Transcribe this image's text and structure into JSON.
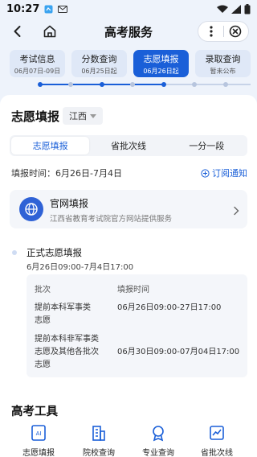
{
  "status_bar": {
    "time": "10:27",
    "icons": [
      "app-notification-icon",
      "mail-icon",
      "wifi-icon",
      "signal-icon",
      "battery-icon"
    ]
  },
  "header": {
    "title": "高考服务",
    "icons": [
      "back-icon",
      "home-icon",
      "more-icon",
      "close-icon"
    ]
  },
  "stages": [
    {
      "title": "考试信息",
      "date": "06月07日-09日"
    },
    {
      "title": "分数查询",
      "date": "06月25日起"
    },
    {
      "title": "志愿填报",
      "date": "06月26日起"
    },
    {
      "title": "录取查询",
      "date": "暂未公布"
    }
  ],
  "active_stage": 2,
  "colors": {
    "accent": "#1a5fd8",
    "page_bg": "#eef3fb",
    "panel_bg": "#f4f6fa"
  },
  "volunteer": {
    "section_title": "志愿填报",
    "region": "江西",
    "tabs": [
      "志愿填报",
      "省批次线",
      "一分一段"
    ],
    "active_tab": 0,
    "fill_time": "填报时间：6月26日-7月4日",
    "subscribe": "订阅通知",
    "official": {
      "title": "官网填报",
      "subtitle": "江西省教育考试院官方网站提供服务"
    },
    "formal": {
      "title": "正式志愿填报",
      "time": "6月26日09:00-7月4日17:00"
    },
    "table": {
      "headers": [
        "批次",
        "填报时间"
      ],
      "rows": [
        {
          "batch": [
            "提前本科军事类",
            "志愿"
          ],
          "time": "06月26日09:00-27日17:00"
        },
        {
          "batch": [
            "提前本科非军事类",
            "志愿及其他各批次",
            "志愿"
          ],
          "time": "06月30日09:00-07月04日17:00"
        }
      ]
    }
  },
  "tools": {
    "title": "高考工具",
    "items": [
      {
        "label": "志愿填报",
        "icon": "ai-icon"
      },
      {
        "label": "院校查询",
        "icon": "building-icon"
      },
      {
        "label": "专业查询",
        "icon": "medal-icon"
      },
      {
        "label": "省批次线",
        "icon": "chart-line-icon"
      }
    ]
  }
}
